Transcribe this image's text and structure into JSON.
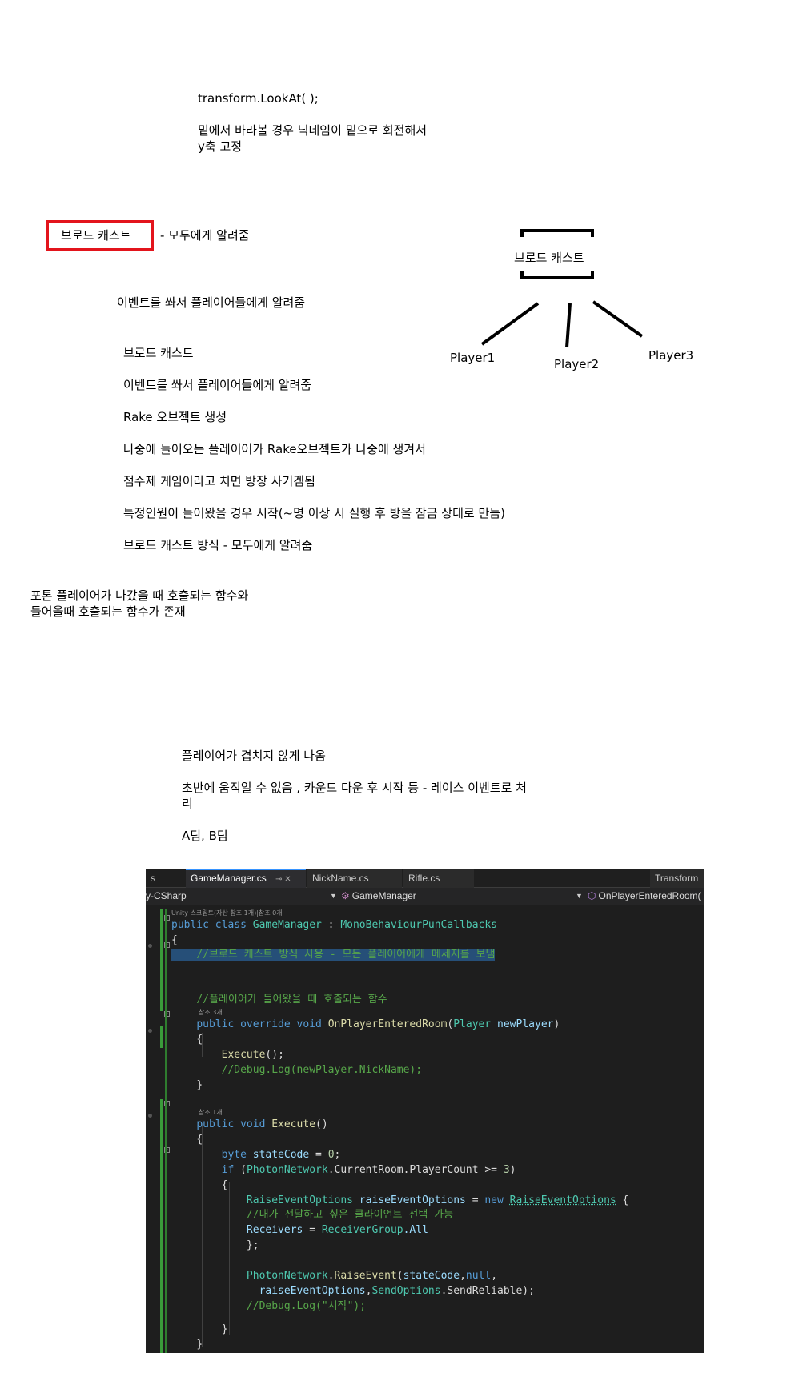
{
  "notes_top": {
    "line1": "transform.LookAt( );",
    "line2": "밑에서 바라볼 경우 닉네임이 밑으로 회전해서",
    "line3": "y축 고정"
  },
  "broadcast_heading": {
    "boxed": "브로드 캐스트",
    "desc": "- 모두에게 알려줌"
  },
  "event_note": "이벤트를 쏴서 플레이어들에게 알려줌",
  "diagram": {
    "box_label": "브로드 캐스트",
    "players": [
      "Player1",
      "Player2",
      "Player3"
    ]
  },
  "list": [
    "브로드 캐스트",
    "이벤트를 쏴서 플레이어들에게 알려줌",
    "Rake 오브젝트 생성",
    "나중에 들어오는 플레이어가 Rake오브젝트가 나중에 생겨서",
    "점수제 게임이라고 치면 방장 사기겜됨",
    "특정인원이 들어왔을 경우 시작(~명 이상 시 실행 후 방을 잠금 상태로 만듬)",
    "브로드 캐스트 방식 - 모두에게 알려줌"
  ],
  "photon_note": {
    "line1": "포톤 플레이어가 나갔을 때 호출되는 함수와",
    "line2": "들어올때 호출되는 함수가 존재"
  },
  "lower_notes": {
    "line1": "플레이어가 겹치지 않게 나옴",
    "line2a": "초반에 움직일 수 없음 , 카운드 다운 후 시작 등 - 레이스 이벤트로 처",
    "line2b": "리",
    "line3": "A팀, B팀"
  },
  "editor": {
    "tabs": {
      "left_fragment": "s",
      "active": "GameManager.cs",
      "active_pin": "⊸ ✕",
      "tab2": "NickName.cs",
      "tab3": "Rifle.cs",
      "right": "Transform"
    },
    "nav": {
      "project": "y-CSharp",
      "class": "GameManager",
      "member": "OnPlayerEnteredRoom("
    },
    "refs": {
      "class_ref": "Unity 스크립트(자산 참조 1개)|참조 0개",
      "method1_ref": "참조 3개",
      "method2_ref": "참조 1개"
    },
    "code": {
      "l_class_kw": "public class ",
      "l_class_name": "GameManager",
      "l_class_colon": " : ",
      "l_class_base": "MonoBehaviourPunCallbacks",
      "brace_open": "{",
      "brace_close": "}",
      "comment_broadcast": "//브로드 캐스트 방식 사용 - 모든 플레이어에게 메세지를 보냄",
      "comment_enter": "//플레이어가 들어왔을 때 호출되는 함수",
      "m1_kw": "public override void ",
      "m1_name": "OnPlayerEnteredRoom",
      "m1_open": "(",
      "m1_ptype": "Player",
      "m1_pname": " newPlayer",
      "m1_close": ")",
      "execute_call": "Execute",
      "execute_tail": "();",
      "comment_debug1": "//Debug.Log(newPlayer.NickName);",
      "m2_kw": "public void ",
      "m2_name": "Execute",
      "m2_tail": "()",
      "byte_kw": "byte",
      "byte_var": " stateCode",
      "byte_eq": " = ",
      "byte_val": "0",
      "semi": ";",
      "if_kw": "if",
      "if_open": " (",
      "if_type": "PhotonNetwork",
      "if_rest1": ".CurrentRoom.PlayerCount >= ",
      "if_num": "3",
      "if_close": ")",
      "reo_type": "RaiseEventOptions",
      "reo_var": " raiseEventOptions",
      "reo_eq": " = ",
      "reo_new": "new ",
      "reo_type2": "RaiseEventOptions",
      "reo_brace": " {",
      "comment_client": "//내가 전달하고 싶은 클라이언트 선택 가능",
      "recv_a": "Receivers",
      "recv_b": " = ",
      "recv_c": "ReceiverGroup",
      "recv_d": ".All",
      "close_init": "};",
      "pn_type": "PhotonNetwork",
      "pn_dot": ".",
      "pn_method": "RaiseEvent",
      "pn_open": "(",
      "pn_arg1": "stateCode",
      "pn_comma": ",",
      "pn_null": "null",
      "pn_comma2": ",",
      "pn2_arg": "raiseEventOptions",
      "pn2_comma": ",",
      "pn2_type": "SendOptions",
      "pn2_rest": ".SendReliable);",
      "comment_debug2a": "//Debug.Log(",
      "comment_debug2b": "\"시작\"",
      "comment_debug2c": ");"
    }
  }
}
